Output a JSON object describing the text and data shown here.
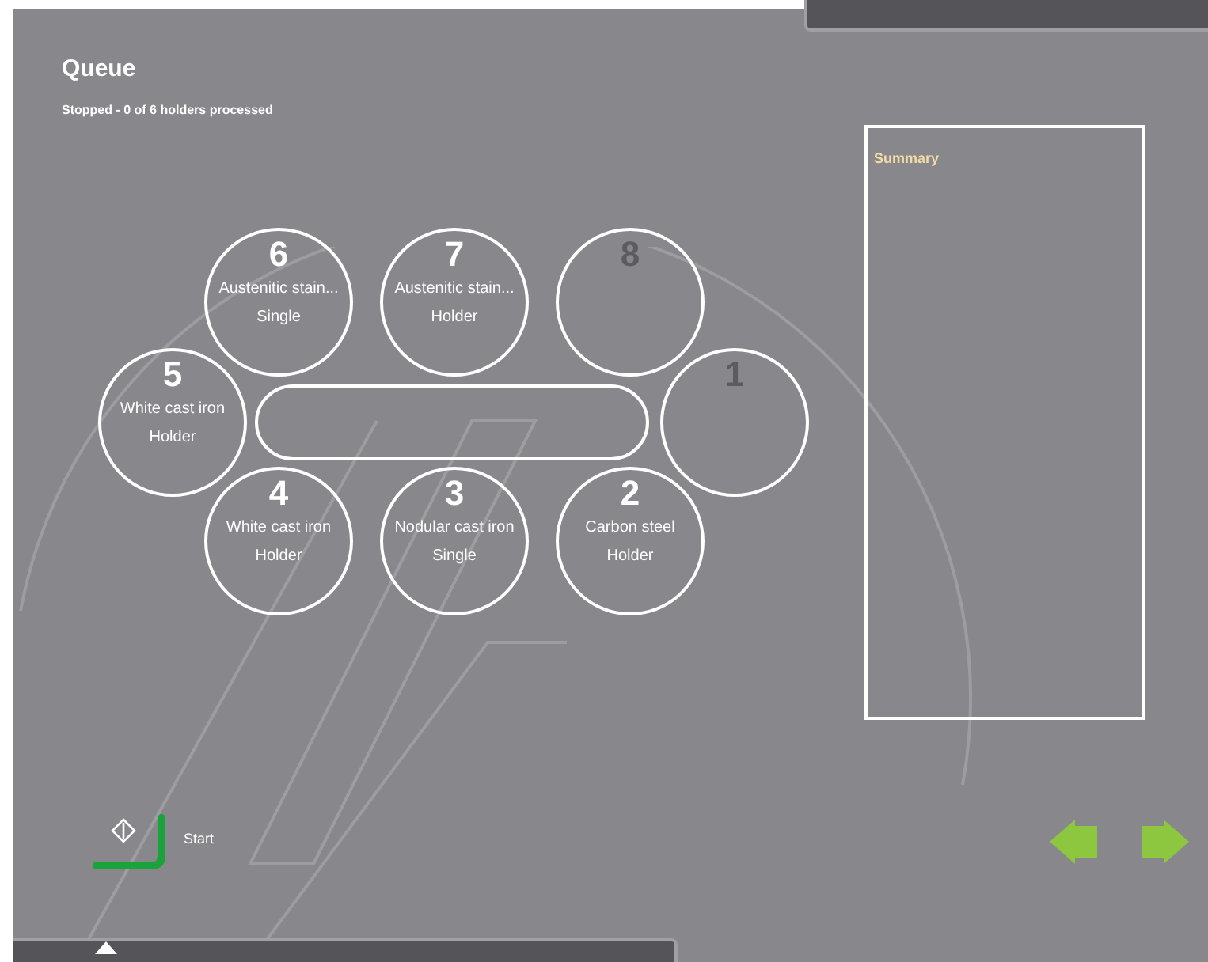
{
  "header": {
    "title": "Queue",
    "status": "Stopped - 0 of 6 holders processed"
  },
  "holders": [
    {
      "number": "6",
      "filled": true,
      "material": "Austenitic stain...",
      "type": "Single"
    },
    {
      "number": "7",
      "filled": true,
      "material": "Austenitic stain...",
      "type": "Holder"
    },
    {
      "number": "8",
      "filled": false
    },
    {
      "number": "5",
      "filled": true,
      "material": "White cast iron",
      "type": "Holder"
    },
    {
      "number": "1",
      "filled": false
    },
    {
      "number": "4",
      "filled": true,
      "material": "White cast iron",
      "type": "Holder"
    },
    {
      "number": "3",
      "filled": true,
      "material": "Nodular cast iron",
      "type": "Single"
    },
    {
      "number": "2",
      "filled": true,
      "material": "Carbon steel",
      "type": "Holder"
    }
  ],
  "summary": {
    "title": "Summary"
  },
  "start_button": {
    "label": "Start"
  }
}
